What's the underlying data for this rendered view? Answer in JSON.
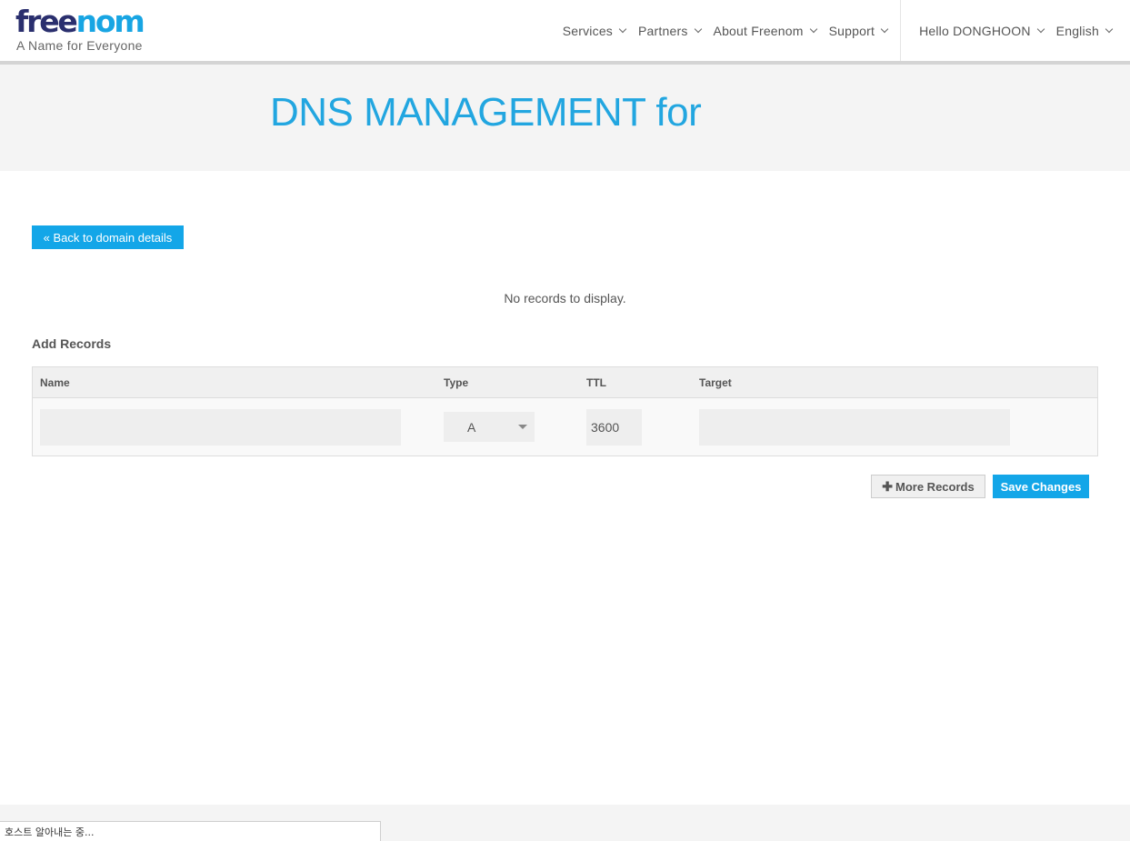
{
  "header": {
    "logo_free": "free",
    "logo_nom": "nom",
    "tagline": "A Name for Everyone",
    "nav": [
      {
        "label": "Services"
      },
      {
        "label": "Partners"
      },
      {
        "label": "About Freenom"
      },
      {
        "label": "Support"
      }
    ],
    "user_label": "Hello DONGHOON",
    "language_label": "English"
  },
  "title_band": {
    "title": "DNS MANAGEMENT for"
  },
  "main": {
    "back_button": "« Back to domain details",
    "empty_message": "No records to display.",
    "add_heading": "Add Records",
    "table": {
      "headers": {
        "name": "Name",
        "type": "Type",
        "ttl": "TTL",
        "target": "Target"
      },
      "row": {
        "name": "",
        "type": "A",
        "ttl": "3600",
        "target": ""
      }
    },
    "more_records_button": "More Records",
    "save_button": "Save Changes"
  },
  "status_bar": {
    "text": "호스트 알아내는 중..."
  },
  "colors": {
    "brand_dark": "#2a2f6e",
    "brand_blue": "#18a5e3",
    "button_blue": "#13a6e8",
    "title_blue": "#22a6e0"
  }
}
